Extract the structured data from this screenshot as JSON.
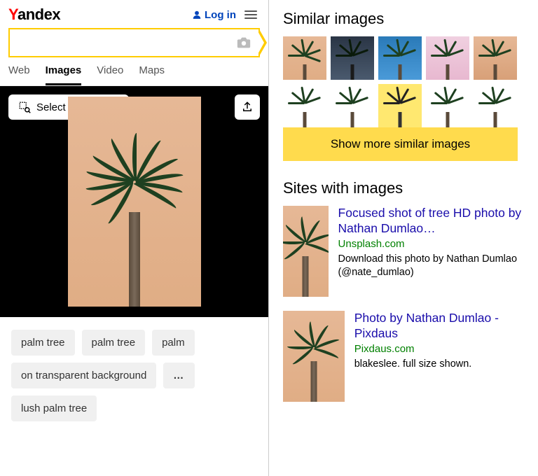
{
  "header": {
    "logo_prefix": "Y",
    "logo_rest": "andex",
    "login_label": "Log in"
  },
  "search": {
    "value": "",
    "placeholder": ""
  },
  "tabs": [
    {
      "label": "Web",
      "active": false
    },
    {
      "label": "Images",
      "active": true
    },
    {
      "label": "Video",
      "active": false
    },
    {
      "label": "Maps",
      "active": false
    }
  ],
  "viewer": {
    "select_fragment_label": "Select a fragment"
  },
  "tags": [
    "palm tree",
    "palm tree",
    "palm",
    "on transparent background",
    "…",
    "lush palm tree"
  ],
  "similar": {
    "title": "Similar images",
    "show_more_label": "Show more similar images"
  },
  "sites": {
    "title": "Sites with images",
    "items": [
      {
        "title": "Focused shot of tree HD photo by Nathan Dumlao…",
        "domain": "Unsplash.com",
        "desc": "Download this photo by Nathan Dumlao (@nate_dumlao)"
      },
      {
        "title": "Photo by Nathan Dumlao - Pixdaus",
        "domain": "Pixdaus.com",
        "desc": "blakeslee. full size shown."
      }
    ]
  }
}
